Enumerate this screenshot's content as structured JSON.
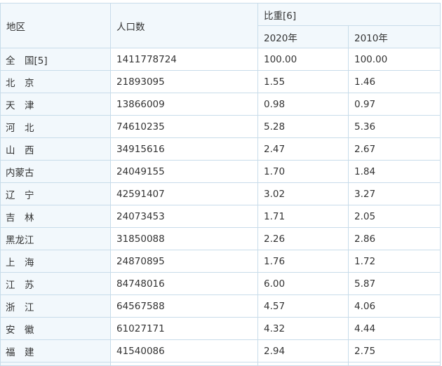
{
  "table": {
    "headers": {
      "region": "地区",
      "population": "人口数",
      "share": "比重[6]",
      "y2020": "2020年",
      "y2010": "2010年"
    },
    "rows": [
      {
        "region": "全　国[5]",
        "population": "1411778724",
        "share2020": "100.00",
        "share2010": "100.00"
      },
      {
        "region": "北　京",
        "population": "21893095",
        "share2020": "1.55",
        "share2010": "1.46"
      },
      {
        "region": "天　津",
        "population": "13866009",
        "share2020": "0.98",
        "share2010": "0.97"
      },
      {
        "region": "河　北",
        "population": "74610235",
        "share2020": "5.28",
        "share2010": "5.36"
      },
      {
        "region": "山　西",
        "population": "34915616",
        "share2020": "2.47",
        "share2010": "2.67"
      },
      {
        "region": "内蒙古",
        "population": "24049155",
        "share2020": "1.70",
        "share2010": "1.84"
      },
      {
        "region": "辽　宁",
        "population": "42591407",
        "share2020": "3.02",
        "share2010": "3.27"
      },
      {
        "region": "吉　林",
        "population": "24073453",
        "share2020": "1.71",
        "share2010": "2.05"
      },
      {
        "region": "黑龙江",
        "population": "31850088",
        "share2020": "2.26",
        "share2010": "2.86"
      },
      {
        "region": "上　海",
        "population": "24870895",
        "share2020": "1.76",
        "share2010": "1.72"
      },
      {
        "region": "江　苏",
        "population": "84748016",
        "share2020": "6.00",
        "share2010": "5.87"
      },
      {
        "region": "浙　江",
        "population": "64567588",
        "share2020": "4.57",
        "share2010": "4.06"
      },
      {
        "region": "安　徽",
        "population": "61027171",
        "share2020": "4.32",
        "share2010": "4.44"
      },
      {
        "region": "福　建",
        "population": "41540086",
        "share2020": "2.94",
        "share2010": "2.75"
      }
    ]
  }
}
